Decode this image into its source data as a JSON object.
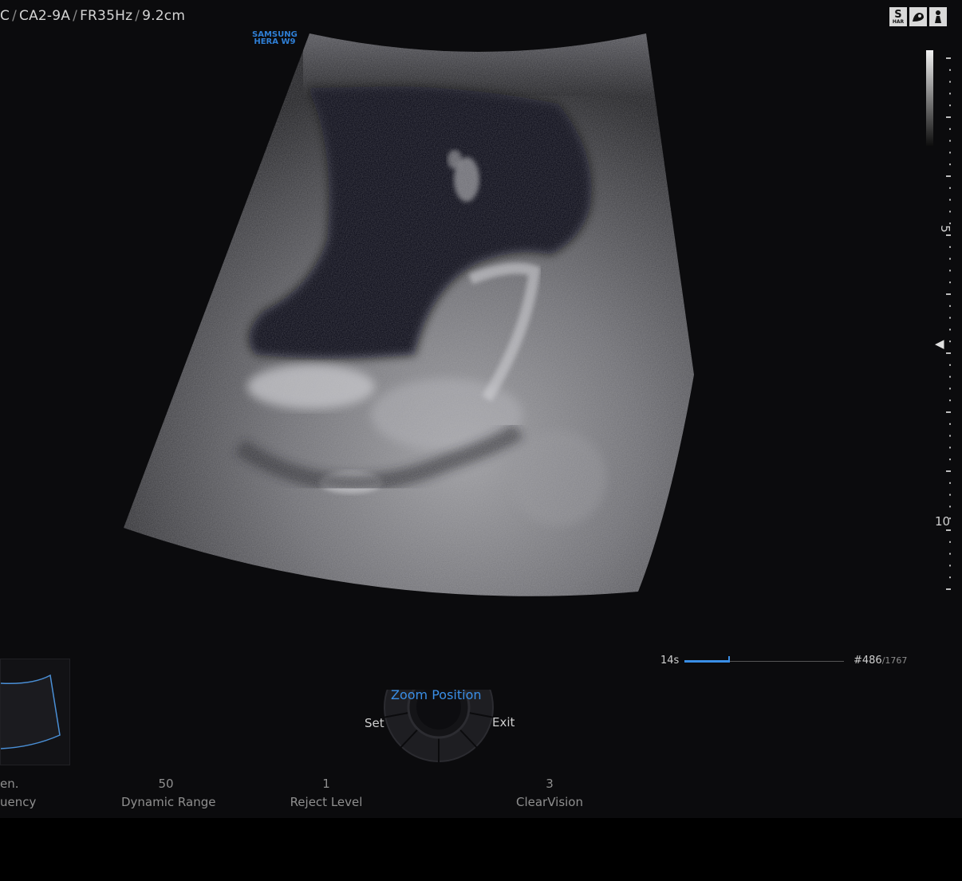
{
  "header": {
    "preset": "C",
    "probe": "CA2-9A",
    "frame_rate": "FR35Hz",
    "depth": "9.2cm"
  },
  "brand": {
    "line1": "SAMSUNG",
    "line2": "HERA W9"
  },
  "mode_icons": [
    {
      "icon": "s-har-icon",
      "label": "S",
      "sub": "HAR"
    },
    {
      "icon": "fetal-icon",
      "label": "◢"
    },
    {
      "icon": "fetal-standing-icon",
      "label": "⍋"
    }
  ],
  "depth_scale": {
    "label_5": "5",
    "label_10": "10"
  },
  "cine": {
    "time": "14s",
    "frame": "#486",
    "total": "/1767",
    "progress": 0.275
  },
  "zoom": {
    "title": "Zoom Position",
    "set_label": "Set",
    "exit_label": "Exit"
  },
  "params": [
    {
      "name": "frequency",
      "value": "",
      "label": "Gen.\nFrequency",
      "shown_value": "",
      "shown_label_top": "en.",
      "shown_label_bottom": "uency"
    },
    {
      "name": "dynamic-range",
      "value": "50",
      "label": "Dynamic Range"
    },
    {
      "name": "reject-level",
      "value": "1",
      "label": "Reject Level"
    },
    {
      "name": "clearvision",
      "value": "3",
      "label": "ClearVision"
    }
  ],
  "colors": {
    "accent": "#3a8ee6",
    "background": "#0b0b0d",
    "text": "#c9c9c9"
  }
}
